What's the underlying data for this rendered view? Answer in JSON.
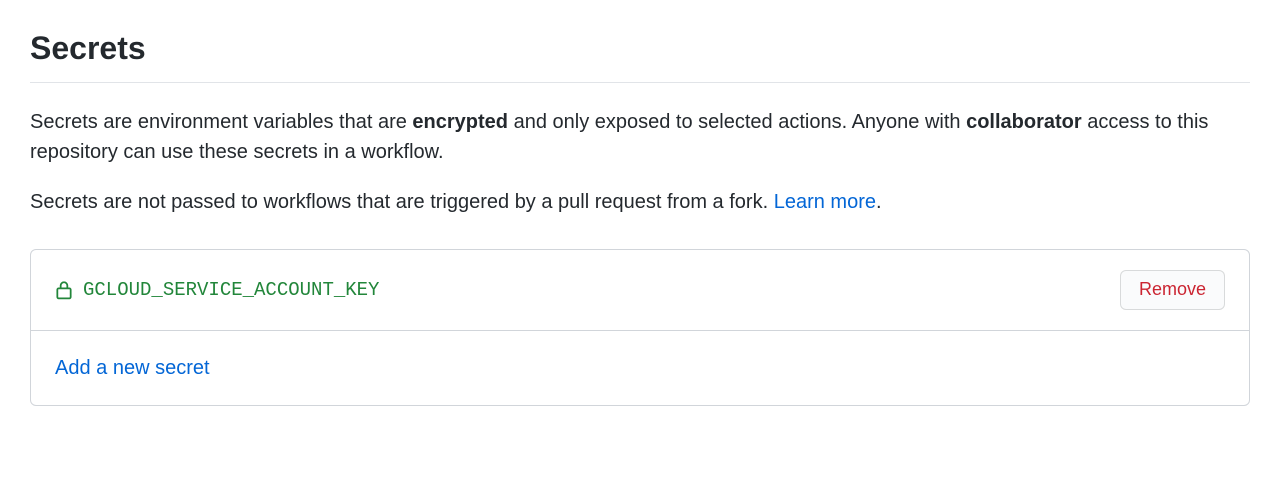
{
  "title": "Secrets",
  "description": {
    "part1": "Secrets are environment variables that are ",
    "bold1": "encrypted",
    "part2": " and only exposed to selected actions. Anyone with ",
    "bold2": "collaborator",
    "part3": " access to this repository can use these secrets in a workflow."
  },
  "note": {
    "text": "Secrets are not passed to workflows that are triggered by a pull request from a fork. ",
    "link_text": "Learn more",
    "suffix": "."
  },
  "secrets": [
    {
      "name": "GCLOUD_SERVICE_ACCOUNT_KEY"
    }
  ],
  "remove_label": "Remove",
  "add_label": "Add a new secret"
}
